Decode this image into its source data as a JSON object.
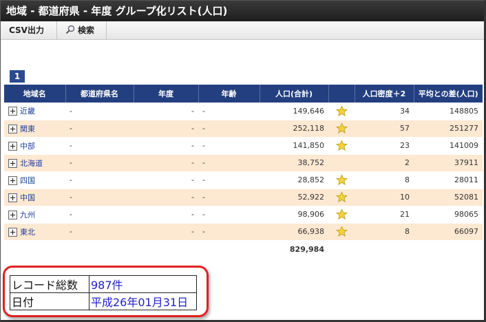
{
  "window": {
    "title": "地域 - 都道府県 - 年度  グループ化リスト(人口)"
  },
  "toolbar": {
    "csv_label": "CSV出力",
    "search_label": "検索"
  },
  "pager": {
    "current_page": "1"
  },
  "table": {
    "headers": [
      "地域名",
      "都道府県名",
      "年度",
      "年齢",
      "人口(合計)",
      "",
      "人口密度＋2",
      "平均との差(人口)"
    ],
    "rows": [
      {
        "region": "近畿",
        "prefecture": "-",
        "year": "-",
        "age": "-",
        "population": "149,646",
        "star": true,
        "density": "34",
        "diff": "148805"
      },
      {
        "region": "関東",
        "prefecture": "-",
        "year": "-",
        "age": "-",
        "population": "252,118",
        "star": true,
        "density": "57",
        "diff": "251277"
      },
      {
        "region": "中部",
        "prefecture": "-",
        "year": "-",
        "age": "-",
        "population": "141,850",
        "star": true,
        "density": "23",
        "diff": "141009"
      },
      {
        "region": "北海道",
        "prefecture": "-",
        "year": "-",
        "age": "-",
        "population": "38,752",
        "star": false,
        "density": "2",
        "diff": "37911"
      },
      {
        "region": "四国",
        "prefecture": "-",
        "year": "-",
        "age": "-",
        "population": "28,852",
        "star": true,
        "density": "8",
        "diff": "28011"
      },
      {
        "region": "中国",
        "prefecture": "-",
        "year": "-",
        "age": "-",
        "population": "52,922",
        "star": true,
        "density": "10",
        "diff": "52081"
      },
      {
        "region": "九州",
        "prefecture": "-",
        "year": "-",
        "age": "-",
        "population": "98,906",
        "star": true,
        "density": "21",
        "diff": "98065"
      },
      {
        "region": "東北",
        "prefecture": "-",
        "year": "-",
        "age": "-",
        "population": "66,938",
        "star": true,
        "density": "8",
        "diff": "66097"
      }
    ],
    "total_population": "829,984"
  },
  "info": {
    "record_count_label": "レコード総数",
    "record_count_value": "987件",
    "date_label": "日付",
    "date_value": "平成26年01月31日"
  },
  "colors": {
    "header_bg": "#233f80",
    "row_alt_bg": "#fde8d2",
    "link": "#1f3f9a",
    "highlight_border": "#e02020",
    "info_value": "#1d1dc8",
    "star": "#f2d43a"
  }
}
